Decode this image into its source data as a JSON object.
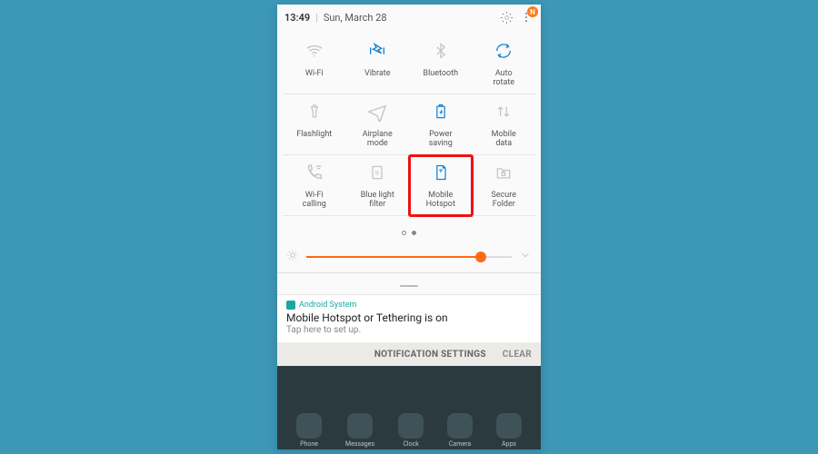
{
  "statusbar": {
    "time": "13:49",
    "date": "Sun, March 28",
    "badge": "N"
  },
  "tiles": [
    {
      "name": "wifi",
      "label": "Wi-Fi",
      "state": "dim"
    },
    {
      "name": "vibrate",
      "label": "Vibrate",
      "state": "active"
    },
    {
      "name": "bluetooth",
      "label": "Bluetooth",
      "state": "dim"
    },
    {
      "name": "autorotate",
      "label": "Auto\nrotate",
      "state": "active"
    },
    {
      "name": "flashlight",
      "label": "Flashlight",
      "state": "dim"
    },
    {
      "name": "airplane",
      "label": "Airplane\nmode",
      "state": "dim"
    },
    {
      "name": "powersaving",
      "label": "Power\nsaving",
      "state": "active"
    },
    {
      "name": "mobiledata",
      "label": "Mobile\ndata",
      "state": "dim"
    },
    {
      "name": "wificalling",
      "label": "Wi-Fi\ncalling",
      "state": "dim"
    },
    {
      "name": "bluelight",
      "label": "Blue light\nfilter",
      "state": "dim"
    },
    {
      "name": "hotspot",
      "label": "Mobile\nHotspot",
      "state": "active",
      "highlight": true
    },
    {
      "name": "securefolder",
      "label": "Secure\nFolder",
      "state": "dim"
    }
  ],
  "brightness": {
    "percent": 85
  },
  "notification": {
    "source": "Android System",
    "title": "Mobile Hotspot or Tethering is on",
    "sub": "Tap here to set up."
  },
  "footer": {
    "settings": "NOTIFICATION SETTINGS",
    "clear": "CLEAR"
  },
  "dock": [
    "Phone",
    "Messages",
    "Clock",
    "Camera",
    "Apps"
  ]
}
